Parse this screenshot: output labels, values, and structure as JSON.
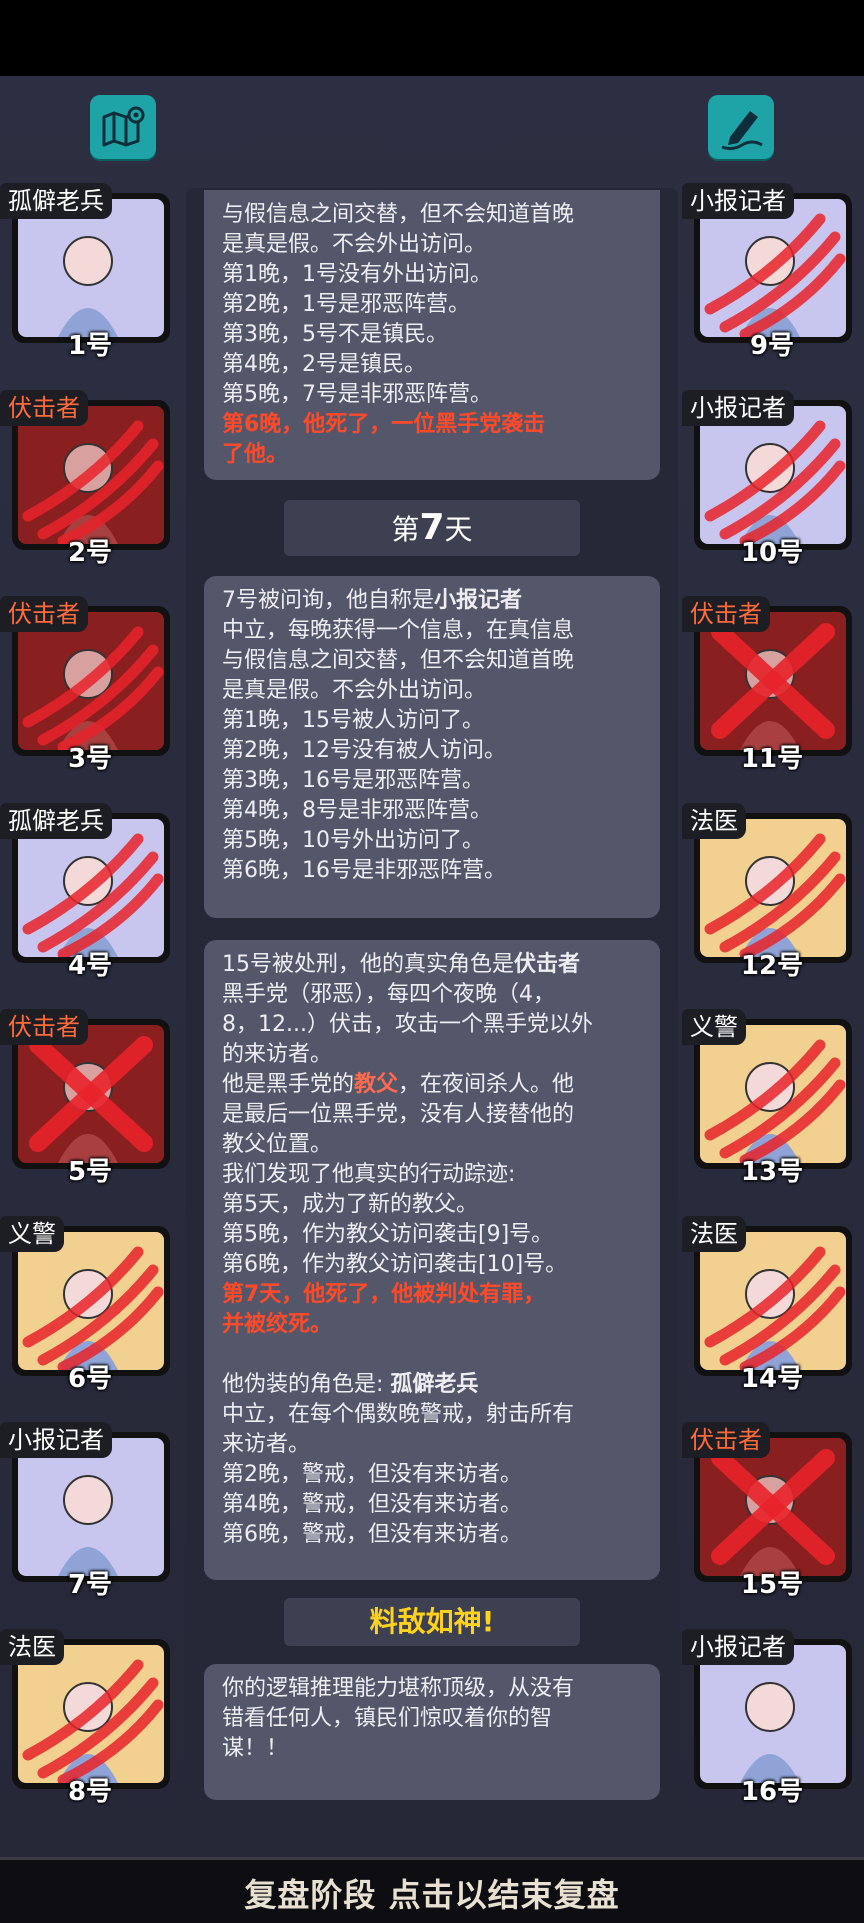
{
  "left_cards": [
    {
      "role": "孤僻老兵",
      "number": "1号",
      "art": "lav",
      "mark": "none",
      "hostile": false
    },
    {
      "role": "伏击者",
      "number": "2号",
      "art": "red",
      "mark": "claw",
      "hostile": true
    },
    {
      "role": "伏击者",
      "number": "3号",
      "art": "red",
      "mark": "claw",
      "hostile": true
    },
    {
      "role": "孤僻老兵",
      "number": "4号",
      "art": "lav",
      "mark": "claw",
      "hostile": false
    },
    {
      "role": "伏击者",
      "number": "5号",
      "art": "red",
      "mark": "cross",
      "hostile": true
    },
    {
      "role": "义警",
      "number": "6号",
      "art": "yel",
      "mark": "claw",
      "hostile": false
    },
    {
      "role": "小报记者",
      "number": "7号",
      "art": "lav",
      "mark": "none",
      "hostile": false
    },
    {
      "role": "法医",
      "number": "8号",
      "art": "yel",
      "mark": "claw",
      "hostile": false
    }
  ],
  "right_cards": [
    {
      "role": "小报记者",
      "number": "9号",
      "art": "lav",
      "mark": "claw",
      "hostile": false
    },
    {
      "role": "小报记者",
      "number": "10号",
      "art": "lav",
      "mark": "claw",
      "hostile": false
    },
    {
      "role": "伏击者",
      "number": "11号",
      "art": "red",
      "mark": "cross",
      "hostile": true
    },
    {
      "role": "法医",
      "number": "12号",
      "art": "yel",
      "mark": "claw",
      "hostile": false
    },
    {
      "role": "义警",
      "number": "13号",
      "art": "yel",
      "mark": "claw",
      "hostile": false
    },
    {
      "role": "法医",
      "number": "14号",
      "art": "yel",
      "mark": "claw",
      "hostile": false
    },
    {
      "role": "伏击者",
      "number": "15号",
      "art": "red",
      "mark": "cross",
      "hostile": true
    },
    {
      "role": "小报记者",
      "number": "16号",
      "art": "lav",
      "mark": "none",
      "hostile": false
    }
  ],
  "msg1": {
    "lines": [
      "与假信息之间交替，但不会知道首晚",
      "是真是假。不会外出访问。",
      "第1晚，1号没有外出访问。",
      "第2晚，1号是邪恶阵营。",
      "第3晚，5号不是镇民。",
      "第4晚，2号是镇民。",
      "第5晚，7号是非邪恶阵营。"
    ],
    "red_lines": [
      "第6晚，他死了，一位黑手党袭击",
      "了他。"
    ]
  },
  "day": {
    "prefix": "第",
    "number": "7",
    "suffix": "天"
  },
  "msg2": {
    "intro_prefix": "7号被问询，他自称是",
    "intro_role": "小报记者",
    "lines": [
      "中立，每晚获得一个信息，在真信息",
      "与假信息之间交替，但不会知道首晚",
      "是真是假。不会外出访问。",
      "第1晚，15号被人访问了。",
      "第2晚，12号没有被人访问。",
      "第3晚，16号是邪恶阵营。",
      "第4晚，8号是非邪恶阵营。",
      "第5晚，10号外出访问了。",
      "第6晚，16号是非邪恶阵营。"
    ]
  },
  "msg3": {
    "intro_prefix": "15号被处刑，他的真实角色是",
    "intro_role": "伏击者",
    "desc": [
      "黑手党（邪恶），每四个夜晚（4，",
      "8，12...）伏击，攻击一个黑手党以外",
      "的来访者。"
    ],
    "godfather_prefix": "他是黑手党的",
    "godfather_word": "教父",
    "godfather_suffix": "，在夜间杀人。他",
    "godfather_lines": [
      "是最后一位黑手党，没有人接替他的",
      "教父位置。",
      "我们发现了他真实的行动踪迹:",
      "第5天，成为了新的教父。",
      "第5晚，作为教父访问袭击[9]号。",
      "第6晚，作为教父访问袭击[10]号。"
    ],
    "red_lines": [
      "第7天，他死了，他被判处有罪，",
      "并被绞死。"
    ],
    "disguise_prefix": "他伪装的角色是: ",
    "disguise_role": "孤僻老兵",
    "disguise_lines": [
      "中立，在每个偶数晚警戒，射击所有",
      "来访者。",
      "第2晚，警戒，但没有来访者。",
      "第4晚，警戒，但没有来访者。",
      "第6晚，警戒，但没有来访者。"
    ]
  },
  "praise_title": "料敌如神!",
  "msg4": {
    "lines": [
      "你的逻辑推理能力堪称顶级，从没有",
      "错看任何人，镇民们惊叹着你的智",
      "谋！！"
    ]
  },
  "bottom_text": "复盘阶段 点击以结束复盘",
  "colors": {
    "accent_teal": "#1ea3a6",
    "hostile_red": "#ff4a2a",
    "praise_gold": "#ffd21f"
  }
}
